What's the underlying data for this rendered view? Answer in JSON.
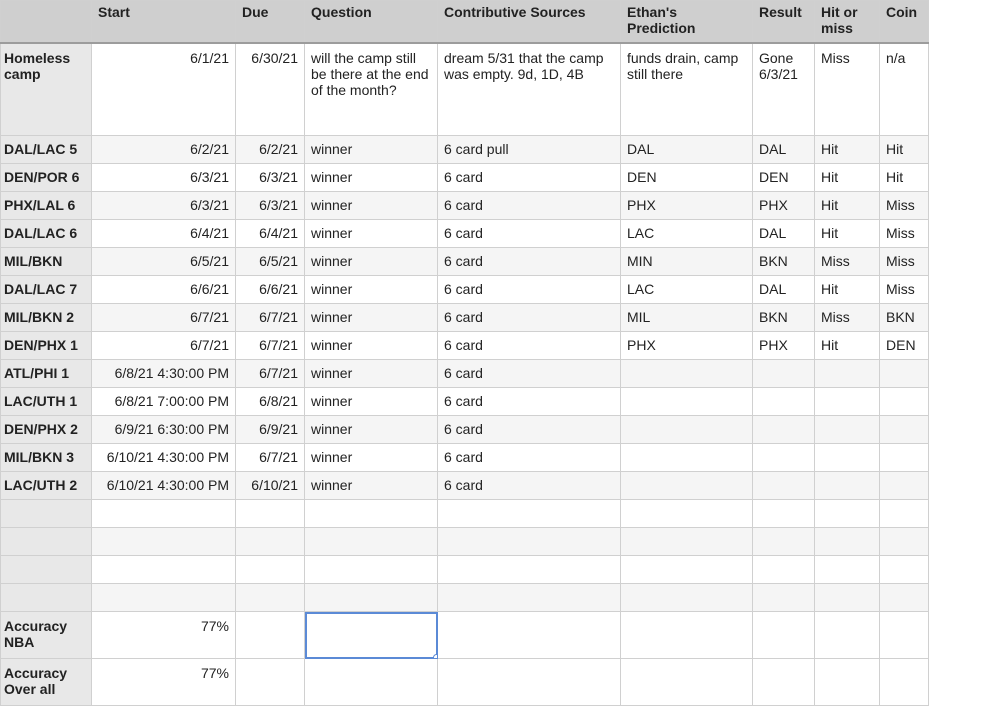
{
  "headers": {
    "start": "Start",
    "due": "Due",
    "question": "Question",
    "sources": "Contributive Sources",
    "prediction": "Ethan's Prediction",
    "result": "Result",
    "hitmiss": "Hit or miss",
    "coin": "Coin"
  },
  "rows": [
    {
      "label": "Homeless camp",
      "start": "6/1/21",
      "due": "6/30/21",
      "question": "will the camp still be there at the end of the month?",
      "sources": "dream 5/31 that the camp was empty. 9d, 1D, 4B",
      "prediction": "funds drain, camp still there",
      "result": "Gone 6/3/21",
      "hitmiss": "Miss",
      "coin": "n/a"
    },
    {
      "label": "DAL/LAC 5",
      "start": "6/2/21",
      "due": "6/2/21",
      "question": "winner",
      "sources": "6 card pull",
      "prediction": "DAL",
      "result": "DAL",
      "hitmiss": "Hit",
      "coin": "Hit"
    },
    {
      "label": "DEN/POR 6",
      "start": "6/3/21",
      "due": "6/3/21",
      "question": "winner",
      "sources": "6 card",
      "prediction": "DEN",
      "result": "DEN",
      "hitmiss": "Hit",
      "coin": "Hit"
    },
    {
      "label": "PHX/LAL 6",
      "start": "6/3/21",
      "due": "6/3/21",
      "question": "winner",
      "sources": "6 card",
      "prediction": "PHX",
      "result": "PHX",
      "hitmiss": "Hit",
      "coin": "Miss"
    },
    {
      "label": "DAL/LAC 6",
      "start": "6/4/21",
      "due": "6/4/21",
      "question": "winner",
      "sources": "6 card",
      "prediction": "LAC",
      "result": "DAL",
      "hitmiss": "Hit",
      "coin": "Miss"
    },
    {
      "label": "MIL/BKN",
      "start": "6/5/21",
      "due": "6/5/21",
      "question": "winner",
      "sources": "6 card",
      "prediction": "MIN",
      "result": "BKN",
      "hitmiss": "Miss",
      "coin": "Miss"
    },
    {
      "label": "DAL/LAC 7",
      "start": "6/6/21",
      "due": "6/6/21",
      "question": "winner",
      "sources": "6 card",
      "prediction": "LAC",
      "result": "DAL",
      "hitmiss": "Hit",
      "coin": "Miss"
    },
    {
      "label": "MIL/BKN 2",
      "start": "6/7/21",
      "due": "6/7/21",
      "question": "winner",
      "sources": "6 card",
      "prediction": "MIL",
      "result": "BKN",
      "hitmiss": "Miss",
      "coin": "BKN"
    },
    {
      "label": "DEN/PHX 1",
      "start": "6/7/21",
      "due": "6/7/21",
      "question": "winner",
      "sources": "6 card",
      "prediction": "PHX",
      "result": "PHX",
      "hitmiss": "Hit",
      "coin": "DEN"
    },
    {
      "label": "ATL/PHI 1",
      "start": "6/8/21 4:30:00 PM",
      "due": "6/7/21",
      "question": "winner",
      "sources": "6 card",
      "prediction": "",
      "result": "",
      "hitmiss": "",
      "coin": ""
    },
    {
      "label": "LAC/UTH 1",
      "start": "6/8/21 7:00:00 PM",
      "due": "6/8/21",
      "question": "winner",
      "sources": "6 card",
      "prediction": "",
      "result": "",
      "hitmiss": "",
      "coin": ""
    },
    {
      "label": "DEN/PHX 2",
      "start": "6/9/21 6:30:00 PM",
      "due": "6/9/21",
      "question": "winner",
      "sources": "6 card",
      "prediction": "",
      "result": "",
      "hitmiss": "",
      "coin": ""
    },
    {
      "label": "MIL/BKN 3",
      "start": "6/10/21 4:30:00 PM",
      "due": "6/7/21",
      "question": "winner",
      "sources": "6 card",
      "prediction": "",
      "result": "",
      "hitmiss": "",
      "coin": ""
    },
    {
      "label": "LAC/UTH 2",
      "start": "6/10/21 4:30:00 PM",
      "due": "6/10/21",
      "question": "winner",
      "sources": "6 card",
      "prediction": "",
      "result": "",
      "hitmiss": "",
      "coin": ""
    }
  ],
  "accuracy": [
    {
      "label": "Accuracy NBA",
      "value": "77%"
    },
    {
      "label": "Accuracy Over all",
      "value": "77%"
    }
  ],
  "colors": {
    "selection": "#5b8ad6",
    "header_bg": "#cfcfcf",
    "rowhead_bg": "#e8e8e8"
  }
}
